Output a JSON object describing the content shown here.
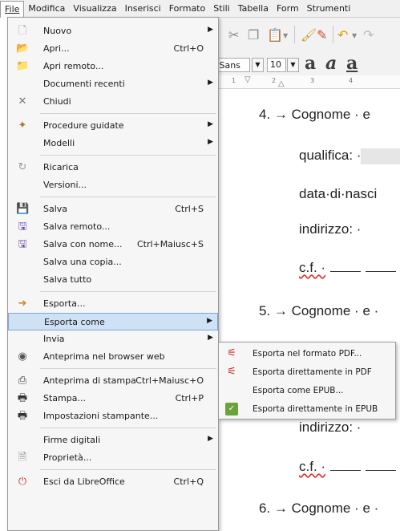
{
  "menubar": {
    "items": [
      "File",
      "Modifica",
      "Visualizza",
      "Inserisci",
      "Formato",
      "Stili",
      "Tabella",
      "Form",
      "Strumenti"
    ]
  },
  "toolbar": {
    "font_name": "n Sans",
    "font_size": "10"
  },
  "ruler": {
    "ticks": [
      "1",
      "2",
      "3",
      "4"
    ]
  },
  "document": {
    "line1": "4. → Cognome · e",
    "line2": "qualifica: ·",
    "line3": "data·di·nasci",
    "line4": "indirizzo: ·",
    "line5": "c.f. ·",
    "line6": "5. → Cognome · e ·",
    "line7": "indirizzo: ·",
    "line8": "c.f. ·",
    "line9": "6. → Cognome · e ·"
  },
  "file_menu": {
    "items": [
      {
        "label": "Nuovo",
        "shortcut": "",
        "submenu": true,
        "icon": "new-document-icon"
      },
      {
        "label": "Apri...",
        "shortcut": "Ctrl+O",
        "submenu": false,
        "icon": "open-folder-icon"
      },
      {
        "label": "Apri remoto...",
        "shortcut": "",
        "submenu": false,
        "icon": "open-remote-icon"
      },
      {
        "label": "Documenti recenti",
        "shortcut": "",
        "submenu": true,
        "icon": ""
      },
      {
        "label": "Chiudi",
        "shortcut": "",
        "submenu": false,
        "icon": "close-icon"
      },
      {
        "label": "Procedure guidate",
        "shortcut": "",
        "submenu": true,
        "icon": "wizard-icon"
      },
      {
        "label": "Modelli",
        "shortcut": "",
        "submenu": true,
        "icon": ""
      },
      {
        "label": "Ricarica",
        "shortcut": "",
        "submenu": false,
        "icon": "reload-icon"
      },
      {
        "label": "Versioni...",
        "shortcut": "",
        "submenu": false,
        "icon": ""
      },
      {
        "label": "Salva",
        "shortcut": "Ctrl+S",
        "submenu": false,
        "icon": "save-icon"
      },
      {
        "label": "Salva remoto...",
        "shortcut": "",
        "submenu": false,
        "icon": "save-remote-icon"
      },
      {
        "label": "Salva con nome...",
        "shortcut": "Ctrl+Maiusc+S",
        "submenu": false,
        "icon": "save-as-icon"
      },
      {
        "label": "Salva una copia...",
        "shortcut": "",
        "submenu": false,
        "icon": ""
      },
      {
        "label": "Salva tutto",
        "shortcut": "",
        "submenu": false,
        "icon": ""
      },
      {
        "label": "Esporta...",
        "shortcut": "",
        "submenu": false,
        "icon": "export-icon"
      },
      {
        "label": "Esporta come",
        "shortcut": "",
        "submenu": true,
        "icon": ""
      },
      {
        "label": "Invia",
        "shortcut": "",
        "submenu": true,
        "icon": ""
      },
      {
        "label": "Anteprima nel browser web",
        "shortcut": "",
        "submenu": false,
        "icon": "browser-preview-icon"
      },
      {
        "label": "Anteprima di stampa",
        "shortcut": "Ctrl+Maiusc+O",
        "submenu": false,
        "icon": "print-preview-icon"
      },
      {
        "label": "Stampa...",
        "shortcut": "Ctrl+P",
        "submenu": false,
        "icon": "print-icon"
      },
      {
        "label": "Impostazioni stampante...",
        "shortcut": "",
        "submenu": false,
        "icon": "printer-settings-icon"
      },
      {
        "label": "Firme digitali",
        "shortcut": "",
        "submenu": true,
        "icon": ""
      },
      {
        "label": "Proprietà...",
        "shortcut": "",
        "submenu": false,
        "icon": "properties-icon"
      },
      {
        "label": "Esci da LibreOffice",
        "shortcut": "Ctrl+Q",
        "submenu": false,
        "icon": "exit-icon"
      }
    ]
  },
  "export_submenu": {
    "items": [
      {
        "label": "Esporta nel formato PDF...",
        "icon": "pdf-icon"
      },
      {
        "label": "Esporta direttamente in PDF",
        "icon": "pdf-icon"
      },
      {
        "label": "Esporta come EPUB...",
        "icon": ""
      },
      {
        "label": "Esporta direttamente in EPUB",
        "icon": "epub-icon"
      }
    ]
  }
}
